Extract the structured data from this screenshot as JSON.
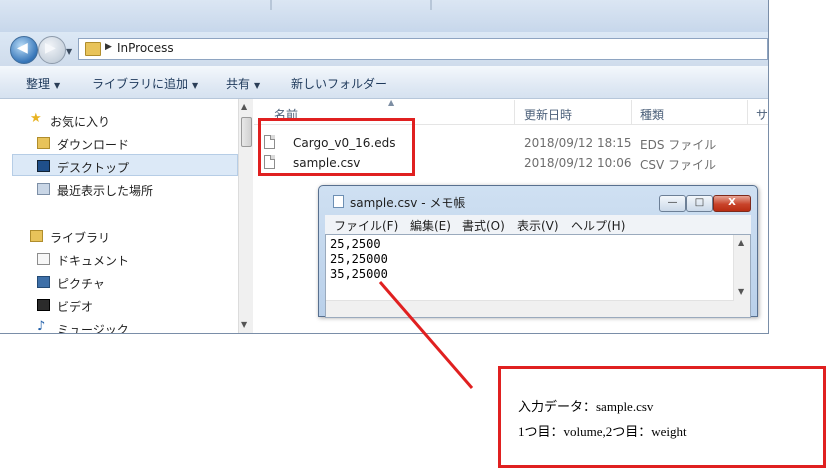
{
  "explorer": {
    "address": {
      "path": "InProcess"
    },
    "toolbar": [
      {
        "label": "整理",
        "has_dropdown": true
      },
      {
        "label": "ライブラリに追加",
        "has_dropdown": true
      },
      {
        "label": "共有",
        "has_dropdown": true
      },
      {
        "label": "新しいフォルダー",
        "has_dropdown": false
      }
    ],
    "nav": {
      "favorites_label": "お気に入り",
      "items": [
        {
          "label": "ダウンロード",
          "icon": "download-folder-icon"
        },
        {
          "label": "デスクトップ",
          "icon": "desktop-icon",
          "selected": true
        },
        {
          "label": "最近表示した場所",
          "icon": "recent-places-icon"
        }
      ],
      "libraries_label": "ライブラリ",
      "library_items": [
        {
          "label": "ドキュメント",
          "icon": "documents-icon"
        },
        {
          "label": "ピクチャ",
          "icon": "pictures-icon"
        },
        {
          "label": "ビデオ",
          "icon": "videos-icon"
        },
        {
          "label": "ミュージック",
          "icon": "music-icon"
        }
      ]
    },
    "columns": {
      "name": "名前",
      "date": "更新日時",
      "type": "種類",
      "size": "サ"
    },
    "files": [
      {
        "name": "Cargo_v0_16.eds",
        "date": "2018/09/12 18:15",
        "type": "EDS ファイル"
      },
      {
        "name": "sample.csv",
        "date": "2018/09/12 10:06",
        "type": "CSV ファイル"
      }
    ]
  },
  "notepad": {
    "title": "sample.csv - メモ帳",
    "menus": [
      "ファイル(F)",
      "編集(E)",
      "書式(O)",
      "表示(V)",
      "ヘルプ(H)"
    ],
    "lines": [
      "25,2500",
      "25,25000",
      "35,25000"
    ],
    "controls": {
      "minimize": "—",
      "maximize": "□",
      "close": "X"
    }
  },
  "annotation": {
    "line1": "入力データ：sample.csv",
    "line2": "1つ目：volume,2つ目：weight",
    "highlight_color": "#e02020"
  }
}
